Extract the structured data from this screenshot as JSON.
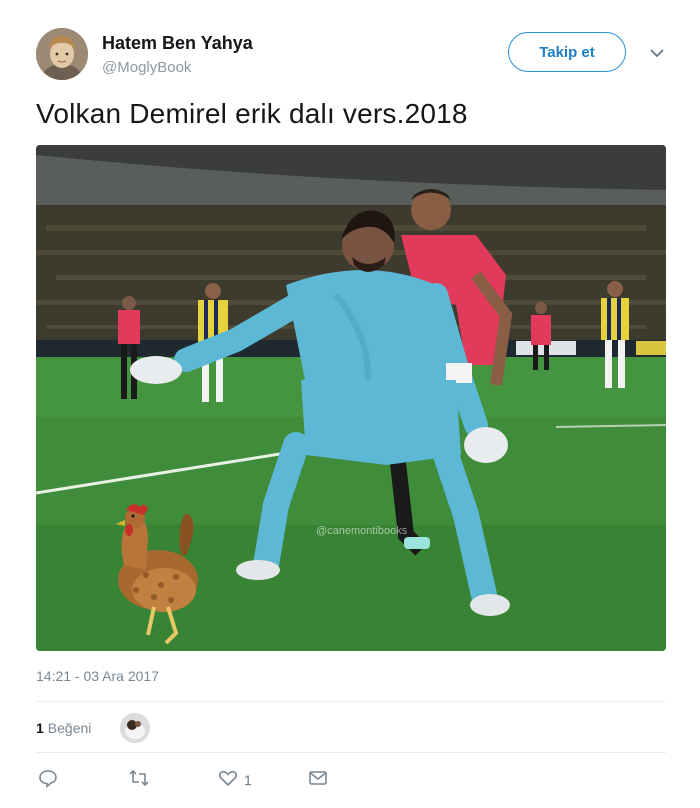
{
  "user": {
    "name": "Hatem Ben Yahya",
    "handle": "@MoglyBook"
  },
  "follow_button": {
    "label": "Takip et"
  },
  "tweet": {
    "text": "Volkan Demirel erik dalı vers.2018",
    "timestamp": "14:21 - 03 Ara 2017",
    "media_watermark": "@canemontibooks"
  },
  "likes": {
    "count": "1",
    "label": "Beğeni"
  },
  "actions": {
    "reply_icon": "reply-icon",
    "retweet_icon": "retweet-icon",
    "like_icon": "heart-icon",
    "like_count": "1",
    "dm_icon": "envelope-icon"
  },
  "colors": {
    "accent": "#1d7fc8",
    "muted": "#7a8792",
    "pitch": "#3f8c3a",
    "keeper_kit": "#5db8d6",
    "opponent_kit": "#e23a5a"
  }
}
